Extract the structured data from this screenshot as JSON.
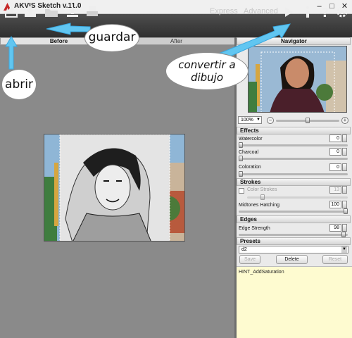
{
  "window": {
    "title": "AKVIS Sketch v.11.0"
  },
  "toolbar": {
    "mode_express": "Express",
    "mode_advanced": "Advanced"
  },
  "tabs": {
    "before": "Before",
    "after": "After"
  },
  "navigator": {
    "title": "Navigator",
    "zoom": "100%"
  },
  "effects": {
    "title": "Effects",
    "watercolor": {
      "label": "Watercolor",
      "value": "0"
    },
    "charcoal": {
      "label": "Charcoal",
      "value": "0"
    },
    "coloration": {
      "label": "Coloration",
      "value": "0"
    }
  },
  "strokes": {
    "title": "Strokes",
    "color_strokes": {
      "label": "Color Strokes",
      "value": "13",
      "checked": false
    },
    "midtones_hatching": {
      "label": "Midtones Hatching",
      "value": "100"
    }
  },
  "edges": {
    "title": "Edges",
    "edge_strength": {
      "label": "Edge Strength",
      "value": "98"
    }
  },
  "presets": {
    "title": "Presets",
    "selected": "d2",
    "save": "Save",
    "delete": "Delete",
    "reset": "Reset"
  },
  "hint": "HINT_AddSaturation",
  "annotations": {
    "save": "guardar",
    "open": "abrir",
    "convert": "convertir a dibujo"
  },
  "colors": {
    "toolbar": "#3c3c3c",
    "canvas": "#8a8a8a",
    "panel": "#eaeaea",
    "hint": "#fefbd0",
    "annotation_arrow": "#61c6f1"
  }
}
